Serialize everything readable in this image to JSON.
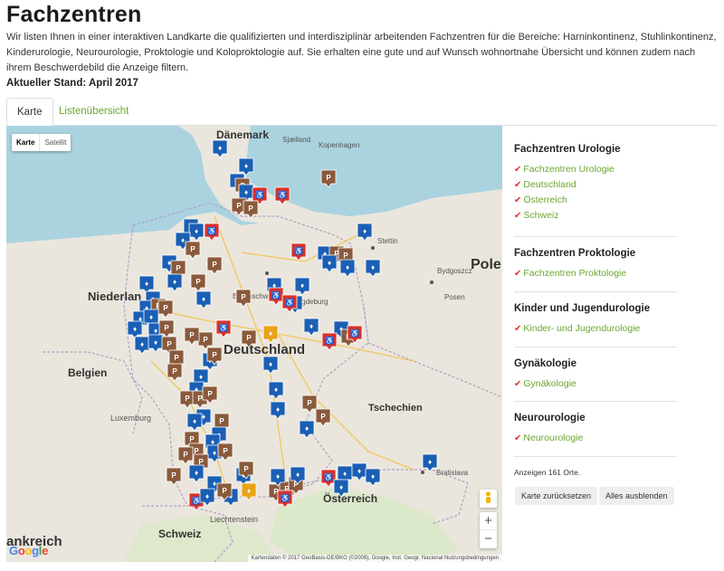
{
  "page": {
    "title": "Fachzentren",
    "intro": "Wir listen Ihnen in einer interaktiven Landkarte die qualifizierten und interdisziplinär arbeitenden Fachzentren für die Bereiche: Harninkontinenz, Stuhlinkontinenz, Kinderurologie, Neurourologie, Proktologie und Koloproktologie auf. Sie erhalten eine gute und auf Wunsch wohnortnahe Übersicht und können zudem nach ihrem Beschwerdebild die Anzeige filtern.",
    "stand": "Aktueller Stand: April 2017"
  },
  "tabs": {
    "karte": "Karte",
    "liste": "Listenübersicht"
  },
  "map": {
    "type_map": "Karte",
    "type_satellite": "Satellit",
    "zoom_in": "+",
    "zoom_out": "−",
    "google": "Google",
    "attribution": "Kartendaten © 2017 GeoBasis-DE/BKG (©2009), Google, Inst. Geogr. Nacional   Nutzungsbedingungen",
    "labels": {
      "daenemark": "Dänemark",
      "seeland": "Sjælland",
      "kopenhagen": "Kopenhagen",
      "stettin": "Stettin",
      "bydgoszcz": "Bydgoszcz",
      "polen": "Pole",
      "posen": "Posen",
      "niederlande": "Niederlan",
      "braunschweig": "Braunschw",
      "magdeburg": "Magdeburg",
      "deutschland": "Deutschland",
      "belgien": "Belgien",
      "luxemburg": "Luxemburg",
      "tschechien": "Tschechien",
      "oesterreich": "Österreich",
      "bratislava": "Bratislava",
      "liechtenstein": "Liechtenstein",
      "schweiz": "Schweiz",
      "frankreich": "ankreich"
    }
  },
  "sidebar": {
    "groups": [
      {
        "title": "Fachzentren Urologie",
        "items": [
          "Fachzentren Urologie",
          "Deutschland",
          "Österreich",
          "Schweiz"
        ]
      },
      {
        "title": "Fachzentren Proktologie",
        "items": [
          "Fachzentren Proktologie"
        ]
      },
      {
        "title": "Kinder und Jugendurologie",
        "items": [
          "Kinder- und Jugendurologie"
        ]
      },
      {
        "title": "Gynäkologie",
        "items": [
          "Gynäkologie"
        ]
      },
      {
        "title": "Neurourologie",
        "items": [
          "Neurourologie"
        ]
      }
    ],
    "count": "Anzeigen 161 Orte.",
    "reset": "Karte zurücksetzen",
    "hide_all": "Alles ausblenden"
  },
  "colors": {
    "accent": "#6aa82e",
    "marker_blue": "#1a5fb4",
    "marker_brown": "#8a5a3c",
    "marker_red": "#d9312b",
    "marker_yellow": "#e8a317"
  }
}
